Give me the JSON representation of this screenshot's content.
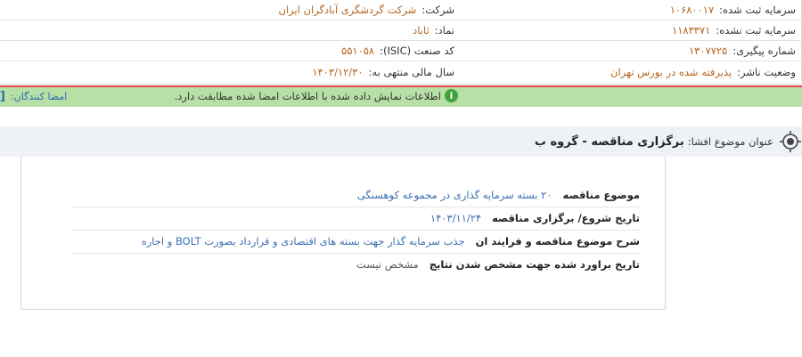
{
  "company_info": {
    "company_label": "شرکت:",
    "company_value": "شرکت گردشگری آبادگران ایران",
    "symbol_label": "نماد:",
    "symbol_value": "ثاباد",
    "isic_label": "کد صنعت (ISIC):",
    "isic_value": "۵۵۱۰۵۸",
    "fiscal_label": "سال مالی منتهی به:",
    "fiscal_value": "۱۴۰۳/۱۲/۳۰",
    "registered_capital_label": "سرمایه ثبت شده:",
    "registered_capital_value": "۱۰۶۸۰۰۱۷",
    "unregistered_capital_label": "سرمایه ثبت نشده:",
    "unregistered_capital_value": "۱۱۸۳۳۷۱",
    "tracking_label": "شماره پیگیری:",
    "tracking_value": "۱۳۰۷۷۲۵",
    "status_label": "وضعیت ناشر:",
    "status_value": "پذیرفته شده در بورس تهران"
  },
  "signature_bar": {
    "message": "اطلاعات نمایش داده شده با اطلاعات امضا شده مطابقت دارد.",
    "signers_label": "امضا کنندگان:",
    "bracket": "[",
    "accent": "#b6e0a6",
    "border": "#e0464f"
  },
  "subject": {
    "label": "عنوان موضوع افشا:",
    "value": "برگزاری مناقصه - گروه ب"
  },
  "details": [
    {
      "label": "موضوع مناقصه",
      "value": "۲۰ بسته سرمایه گذاری در مجموعه کوهسنگی",
      "style": "link"
    },
    {
      "label": "تاریخ شروع/ برگزاری مناقصه",
      "value": "۱۴۰۳/۱۱/۲۴",
      "style": "link"
    },
    {
      "label": "شرح موضوع مناقصه و فرایند ان",
      "value": "جذب سرمایه گذار جهت بسته های اقتصادی و قرارداد بصورت BOLT و اجاره",
      "style": "link"
    },
    {
      "label": "تاریخ براورد شده جهت مشخص شدن نتایج",
      "value": "مشخص نیست",
      "style": "plain"
    }
  ]
}
